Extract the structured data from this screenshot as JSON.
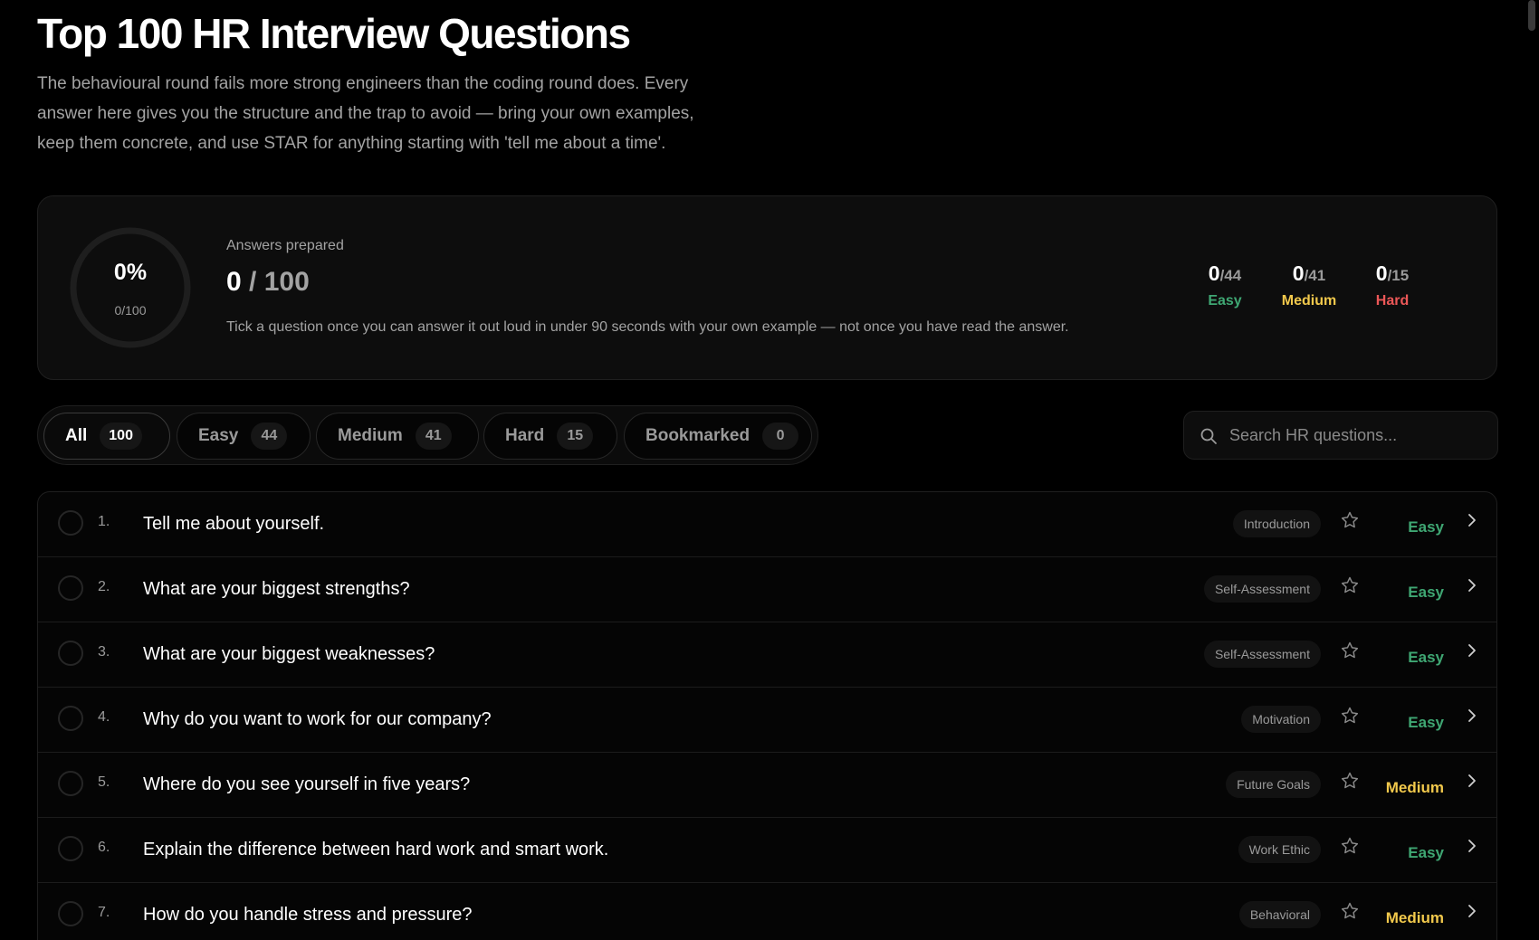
{
  "header": {
    "title": "Top 100 HR Interview Questions",
    "intro": "The behavioural round fails more strong engineers than the coding round does. Every answer here gives you the structure and the trap to avoid — bring your own examples, keep them concrete, and use STAR for anything starting with 'tell me about a time'."
  },
  "progress": {
    "percent_label": "0%",
    "sub_label": "0/100",
    "fraction": 0,
    "answers_label": "Answers prepared",
    "done": "0",
    "total": "/ 100",
    "hint": "Tick a question once you can answer it out loud in under 90 seconds with your own example — not once you have read the answer.",
    "stats": [
      {
        "done": "0",
        "total": "/44",
        "label": "Easy",
        "color": "#3fa773"
      },
      {
        "done": "0",
        "total": "/41",
        "label": "Medium",
        "color": "#f2c94c"
      },
      {
        "done": "0",
        "total": "/15",
        "label": "Hard",
        "color": "#eb5757"
      }
    ]
  },
  "filters": [
    {
      "label": "All",
      "count": "100",
      "active": true
    },
    {
      "label": "Easy",
      "count": "44",
      "active": false
    },
    {
      "label": "Medium",
      "count": "41",
      "active": false
    },
    {
      "label": "Hard",
      "count": "15",
      "active": false
    },
    {
      "label": "Bookmarked",
      "count": "0",
      "active": false
    }
  ],
  "search": {
    "placeholder": "Search HR questions..."
  },
  "colors": {
    "easy": "#3fa773",
    "medium": "#f2c94c",
    "hard": "#eb5757"
  },
  "questions": [
    {
      "num": "1.",
      "text": "Tell me about yourself.",
      "tag": "Introduction",
      "difficulty": "Easy"
    },
    {
      "num": "2.",
      "text": "What are your biggest strengths?",
      "tag": "Self-Assessment",
      "difficulty": "Easy"
    },
    {
      "num": "3.",
      "text": "What are your biggest weaknesses?",
      "tag": "Self-Assessment",
      "difficulty": "Easy"
    },
    {
      "num": "4.",
      "text": "Why do you want to work for our company?",
      "tag": "Motivation",
      "difficulty": "Easy"
    },
    {
      "num": "5.",
      "text": "Where do you see yourself in five years?",
      "tag": "Future Goals",
      "difficulty": "Medium"
    },
    {
      "num": "6.",
      "text": "Explain the difference between hard work and smart work.",
      "tag": "Work Ethic",
      "difficulty": "Easy"
    },
    {
      "num": "7.",
      "text": "How do you handle stress and pressure?",
      "tag": "Behavioral",
      "difficulty": "Medium"
    }
  ]
}
